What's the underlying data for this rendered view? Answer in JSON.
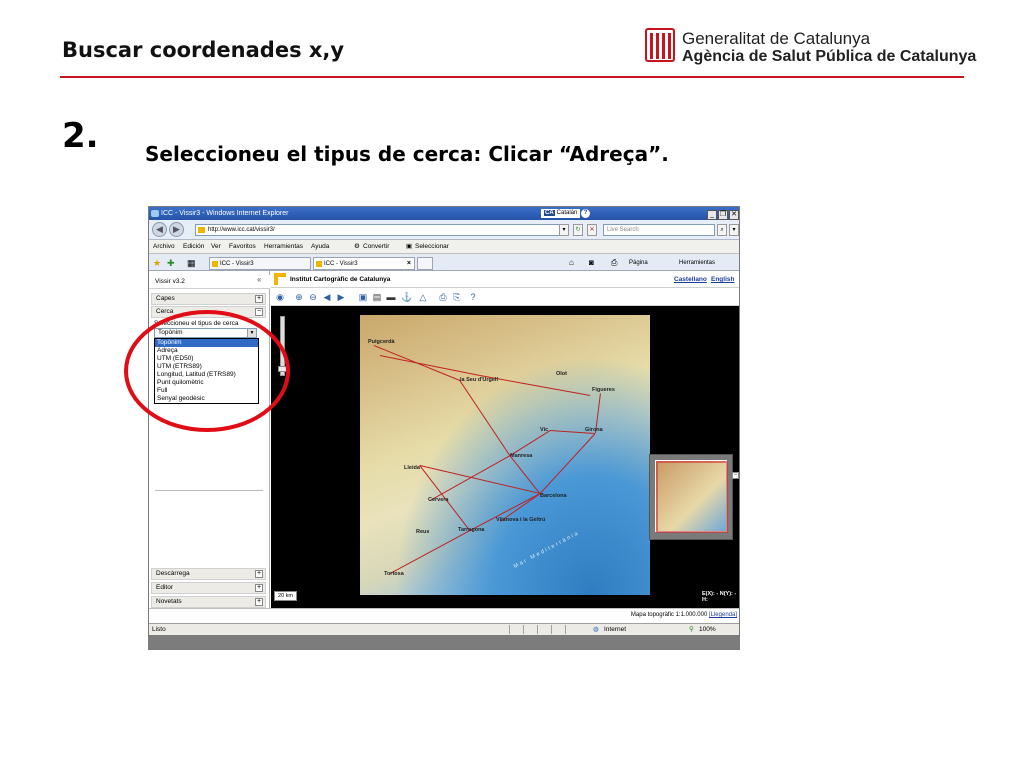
{
  "slide": {
    "title": "Buscar coordenades x,y",
    "org_line1": "Generalitat de Catalunya",
    "org_line2": "Agència de Salut Pública de Catalunya",
    "step_number": "2.",
    "step_text": "Seleccioneu el tipus de cerca: Clicar “Adreça”."
  },
  "browser": {
    "window_title": "ICC - Vissir3 - Windows Internet Explorer",
    "language_code": "CA",
    "language_name": "Catalán",
    "url": "http://www.icc.cat/vissir3/",
    "search_placeholder": "Live Search",
    "menu": [
      "Archivo",
      "Edición",
      "Ver",
      "Favoritos",
      "Herramientas",
      "Ayuda"
    ],
    "menu_tools": {
      "convert": "Convertir",
      "select": "Seleccionar"
    },
    "tabs": [
      {
        "label": "ICC - Vissir3",
        "active": false
      },
      {
        "label": "ICC - Vissir3",
        "active": true
      }
    ],
    "toolbar": {
      "page": "Página",
      "tools": "Herramientas"
    },
    "status": {
      "text": "Listo",
      "zone": "Internet",
      "zoom": "100%"
    }
  },
  "app": {
    "version": "Vissir v3.2",
    "collapse_glyph": "«",
    "sections": {
      "capes": "Capes",
      "cerca": "Cerca",
      "descarrega": "Descàrrega",
      "editor": "Editor",
      "novetats": "Novetats"
    },
    "search_type_label": "Seleccioneu el tipus de cerca",
    "search_type_selected": "Topònim",
    "search_type_options": [
      "Topònim",
      "Adreça",
      "UTM (ED50)",
      "UTM (ETRS89)",
      "Longitud, Latitud (ETRS89)",
      "Punt quilomètric",
      "Full",
      "Senyal geodèsic"
    ],
    "header_title": "Institut Cartogràfic de Catalunya",
    "lang_links": [
      "Castellano",
      "English"
    ],
    "scale_bar": "20 km",
    "coords_readout": "E(X): - N(Y): - H:",
    "map_type_text": "Mapa topogràfic 1:1.000.000",
    "legend_link": "[Llegenda]"
  },
  "map_labels": [
    "Puigcerdà",
    "Girona",
    "Figueres",
    "Lleida",
    "Barcelona",
    "Tarragona",
    "Manresa",
    "Vic",
    "Reus",
    "Tortosa",
    "la Seu d'Urgell",
    "Olot",
    "Cervera",
    "Vilanova i la Geltrú",
    "Mar Mediterrània"
  ],
  "colors": {
    "accent_red": "#c8141e",
    "annotation_red": "#e10d16",
    "selection_blue": "#316ac5",
    "titlebar_blue": "#2553a8"
  }
}
